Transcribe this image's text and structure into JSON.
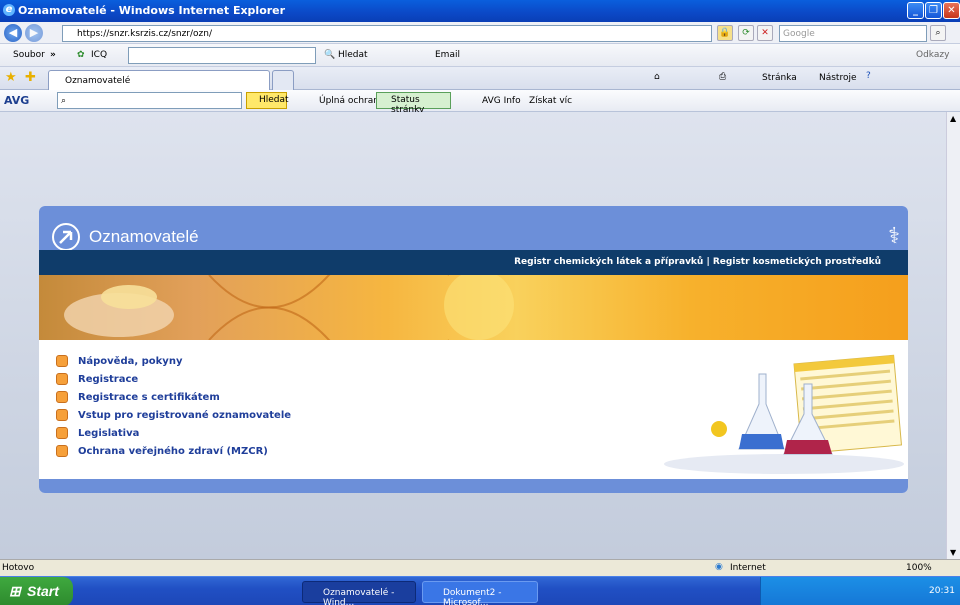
{
  "window": {
    "title": "Oznamovatelé - Windows Internet Explorer"
  },
  "address": {
    "url": "https://snzr.ksrzis.cz/snzr/ozn/",
    "search_placeholder": "Google"
  },
  "menu": {
    "file": "Soubor",
    "icq": "ICQ",
    "search": "Hledat",
    "email": "Email",
    "links": "Odkazy"
  },
  "tab": {
    "title": "Oznamovatelé"
  },
  "commandbar": {
    "page": "Stránka",
    "tools": "Nástroje"
  },
  "avg": {
    "logo": "AVG",
    "search": "Hledat",
    "full_protection": "Úplná ochrana",
    "page_status": "Status stránky",
    "info": "AVG Info",
    "get_more": "Získat víc"
  },
  "page": {
    "title": "Oznamovatelé",
    "nav_text": "Registr chemických látek a přípravků  |  Registr kosmetických prostředků",
    "links": [
      "Nápověda, pokyny",
      "Registrace",
      "Registrace s certifikátem",
      "Vstup pro registrované oznamovatele",
      "Legislativa",
      "Ochrana veřejného zdraví (MZCR)"
    ]
  },
  "status": {
    "left": "Hotovo",
    "zone": "Internet",
    "zoom": "100%"
  },
  "taskbar": {
    "start": "Start",
    "tasks": [
      "Oznamovatelé - Wind...",
      "Dokument2 - Microsof..."
    ],
    "clock": "20:31"
  },
  "colors": {
    "header_blue": "#6c8fd9",
    "nav_dark": "#0f3c6a",
    "link_blue": "#1f3e9a"
  }
}
